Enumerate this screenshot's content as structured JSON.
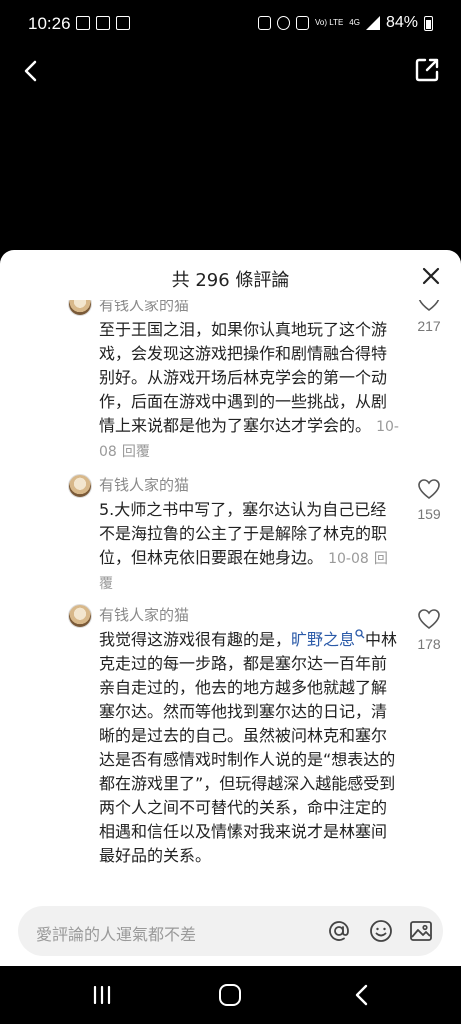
{
  "status_bar": {
    "time": "10:26",
    "net": "Vo) LTE",
    "net2": "4G",
    "battery": "84%"
  },
  "sheet": {
    "title": "共 296 條評論"
  },
  "comments": [
    {
      "author": "有钱人家的猫",
      "text": "至于王国之泪，如果你认真地玩了这个游戏，会发现这游戏把操作和剧情融合得特别好。从游戏开场后林克学会的第一个动作，后面在游戏中遇到的一些挑战，从剧情上来说都是他为了塞尔达才学会的。",
      "date": "10-08",
      "reply": "回覆",
      "likes": "217"
    },
    {
      "author": "有钱人家的猫",
      "text": "5.大师之书中写了，塞尔达认为自己已经不是海拉鲁的公主了于是解除了林克的职位，但林克依旧要跟在她身边。",
      "date": "10-08",
      "reply": "回覆",
      "likes": "159"
    },
    {
      "author": "有钱人家的猫",
      "text_before": "我觉得这游戏很有趣的是，",
      "link": "旷野之息",
      "text_after": "中林克走过的每一步路，都是塞尔达一百年前亲自走过的，他去的地方越多他就越了解塞尔达。然而等他找到塞尔达的日记，清晰的是过去的自己。虽然被问林克和塞尔达是否有感情戏时制作人说的是“想表达的都在游戏里了”，但玩得越深入越能感受到两个人之间不可替代的关系，命中注定的相遇和信任以及情愫对我来说才是林塞间最好品的关系。",
      "likes": "178"
    }
  ],
  "input": {
    "placeholder": "愛評論的人運氣都不差"
  },
  "icons": {
    "back": "chevron-left-icon",
    "share": "share-external-icon",
    "close": "close-icon",
    "like": "heart-outline-icon",
    "mention": "at-sign-icon",
    "emoji": "smiley-icon",
    "image": "image-icon"
  }
}
